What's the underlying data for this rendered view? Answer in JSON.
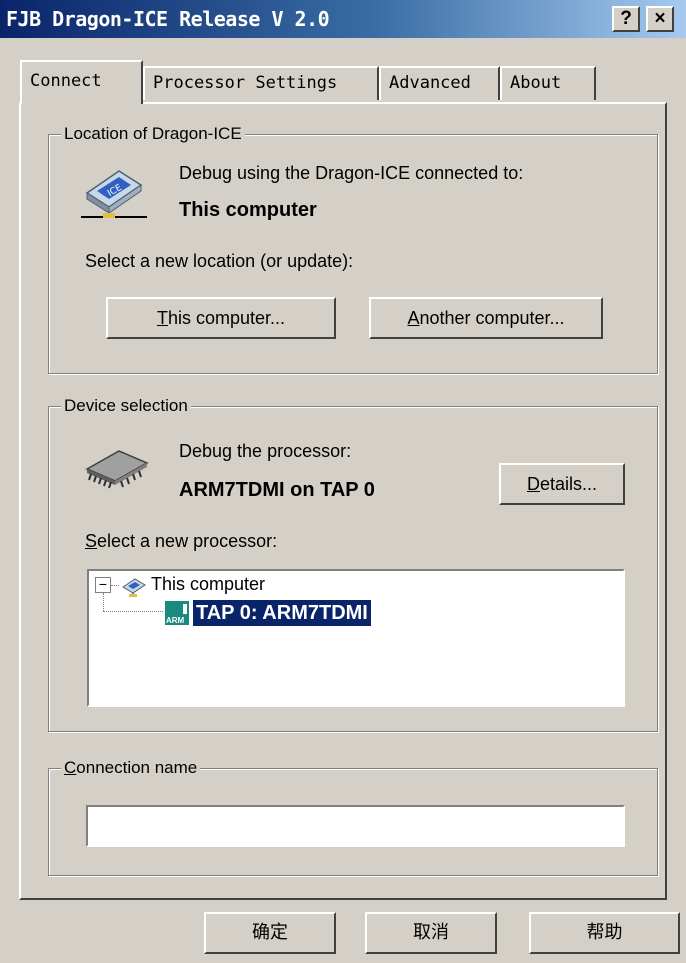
{
  "window": {
    "title": "FJB Dragon-ICE Release V 2.0",
    "help_btn": "?",
    "close_btn": "×"
  },
  "tabs": [
    {
      "label": "Connect",
      "active": true
    },
    {
      "label": "Processor Settings",
      "active": false
    },
    {
      "label": "Advanced",
      "active": false
    },
    {
      "label": "About",
      "active": false
    }
  ],
  "location": {
    "legend": "Location of Dragon-ICE",
    "desc": "Debug using the Dragon-ICE connected to:",
    "current": "This computer",
    "select_label": "Select a new location (or update):",
    "this_computer_btn": {
      "mnemonic": "T",
      "rest": "his computer..."
    },
    "another_computer_btn": {
      "mnemonic": "A",
      "rest": "nother computer..."
    }
  },
  "device": {
    "legend": "Device selection",
    "desc": "Debug the processor:",
    "current": "ARM7TDMI on TAP 0",
    "details_btn": {
      "mnemonic": "D",
      "rest": "etails..."
    },
    "select_label": {
      "mnemonic": "S",
      "rest": "elect a new processor:"
    },
    "tree": {
      "root": {
        "label": "This computer",
        "expander": "⊟"
      },
      "child": {
        "label": "TAP 0: ARM7TDMI",
        "icon_text": "ARM",
        "selected": true
      }
    }
  },
  "connection": {
    "legend": {
      "mnemonic": "C",
      "rest": "onnection name"
    },
    "value": ""
  },
  "footer": {
    "ok": "确定",
    "cancel": "取消",
    "help": "帮助"
  },
  "colors": {
    "titlebar_start": "#0a246a",
    "titlebar_end": "#a6caf0",
    "selection": "#0a246a",
    "face": "#d4d0c8"
  }
}
